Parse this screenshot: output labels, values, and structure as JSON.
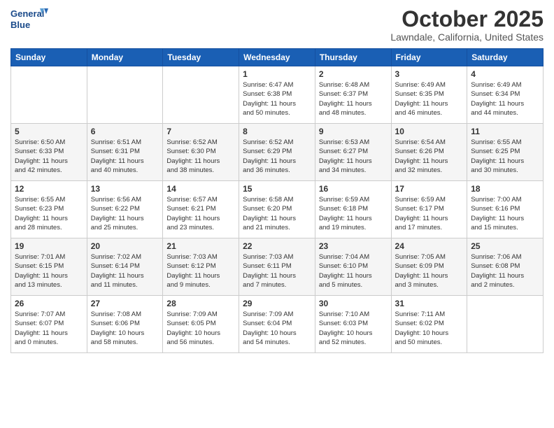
{
  "header": {
    "logo_line1": "General",
    "logo_line2": "Blue",
    "month": "October 2025",
    "location": "Lawndale, California, United States"
  },
  "days_of_week": [
    "Sunday",
    "Monday",
    "Tuesday",
    "Wednesday",
    "Thursday",
    "Friday",
    "Saturday"
  ],
  "weeks": [
    [
      {
        "day": "",
        "info": ""
      },
      {
        "day": "",
        "info": ""
      },
      {
        "day": "",
        "info": ""
      },
      {
        "day": "1",
        "info": "Sunrise: 6:47 AM\nSunset: 6:38 PM\nDaylight: 11 hours\nand 50 minutes."
      },
      {
        "day": "2",
        "info": "Sunrise: 6:48 AM\nSunset: 6:37 PM\nDaylight: 11 hours\nand 48 minutes."
      },
      {
        "day": "3",
        "info": "Sunrise: 6:49 AM\nSunset: 6:35 PM\nDaylight: 11 hours\nand 46 minutes."
      },
      {
        "day": "4",
        "info": "Sunrise: 6:49 AM\nSunset: 6:34 PM\nDaylight: 11 hours\nand 44 minutes."
      }
    ],
    [
      {
        "day": "5",
        "info": "Sunrise: 6:50 AM\nSunset: 6:33 PM\nDaylight: 11 hours\nand 42 minutes."
      },
      {
        "day": "6",
        "info": "Sunrise: 6:51 AM\nSunset: 6:31 PM\nDaylight: 11 hours\nand 40 minutes."
      },
      {
        "day": "7",
        "info": "Sunrise: 6:52 AM\nSunset: 6:30 PM\nDaylight: 11 hours\nand 38 minutes."
      },
      {
        "day": "8",
        "info": "Sunrise: 6:52 AM\nSunset: 6:29 PM\nDaylight: 11 hours\nand 36 minutes."
      },
      {
        "day": "9",
        "info": "Sunrise: 6:53 AM\nSunset: 6:27 PM\nDaylight: 11 hours\nand 34 minutes."
      },
      {
        "day": "10",
        "info": "Sunrise: 6:54 AM\nSunset: 6:26 PM\nDaylight: 11 hours\nand 32 minutes."
      },
      {
        "day": "11",
        "info": "Sunrise: 6:55 AM\nSunset: 6:25 PM\nDaylight: 11 hours\nand 30 minutes."
      }
    ],
    [
      {
        "day": "12",
        "info": "Sunrise: 6:55 AM\nSunset: 6:23 PM\nDaylight: 11 hours\nand 28 minutes."
      },
      {
        "day": "13",
        "info": "Sunrise: 6:56 AM\nSunset: 6:22 PM\nDaylight: 11 hours\nand 25 minutes."
      },
      {
        "day": "14",
        "info": "Sunrise: 6:57 AM\nSunset: 6:21 PM\nDaylight: 11 hours\nand 23 minutes."
      },
      {
        "day": "15",
        "info": "Sunrise: 6:58 AM\nSunset: 6:20 PM\nDaylight: 11 hours\nand 21 minutes."
      },
      {
        "day": "16",
        "info": "Sunrise: 6:59 AM\nSunset: 6:18 PM\nDaylight: 11 hours\nand 19 minutes."
      },
      {
        "day": "17",
        "info": "Sunrise: 6:59 AM\nSunset: 6:17 PM\nDaylight: 11 hours\nand 17 minutes."
      },
      {
        "day": "18",
        "info": "Sunrise: 7:00 AM\nSunset: 6:16 PM\nDaylight: 11 hours\nand 15 minutes."
      }
    ],
    [
      {
        "day": "19",
        "info": "Sunrise: 7:01 AM\nSunset: 6:15 PM\nDaylight: 11 hours\nand 13 minutes."
      },
      {
        "day": "20",
        "info": "Sunrise: 7:02 AM\nSunset: 6:14 PM\nDaylight: 11 hours\nand 11 minutes."
      },
      {
        "day": "21",
        "info": "Sunrise: 7:03 AM\nSunset: 6:12 PM\nDaylight: 11 hours\nand 9 minutes."
      },
      {
        "day": "22",
        "info": "Sunrise: 7:03 AM\nSunset: 6:11 PM\nDaylight: 11 hours\nand 7 minutes."
      },
      {
        "day": "23",
        "info": "Sunrise: 7:04 AM\nSunset: 6:10 PM\nDaylight: 11 hours\nand 5 minutes."
      },
      {
        "day": "24",
        "info": "Sunrise: 7:05 AM\nSunset: 6:09 PM\nDaylight: 11 hours\nand 3 minutes."
      },
      {
        "day": "25",
        "info": "Sunrise: 7:06 AM\nSunset: 6:08 PM\nDaylight: 11 hours\nand 2 minutes."
      }
    ],
    [
      {
        "day": "26",
        "info": "Sunrise: 7:07 AM\nSunset: 6:07 PM\nDaylight: 11 hours\nand 0 minutes."
      },
      {
        "day": "27",
        "info": "Sunrise: 7:08 AM\nSunset: 6:06 PM\nDaylight: 10 hours\nand 58 minutes."
      },
      {
        "day": "28",
        "info": "Sunrise: 7:09 AM\nSunset: 6:05 PM\nDaylight: 10 hours\nand 56 minutes."
      },
      {
        "day": "29",
        "info": "Sunrise: 7:09 AM\nSunset: 6:04 PM\nDaylight: 10 hours\nand 54 minutes."
      },
      {
        "day": "30",
        "info": "Sunrise: 7:10 AM\nSunset: 6:03 PM\nDaylight: 10 hours\nand 52 minutes."
      },
      {
        "day": "31",
        "info": "Sunrise: 7:11 AM\nSunset: 6:02 PM\nDaylight: 10 hours\nand 50 minutes."
      },
      {
        "day": "",
        "info": ""
      }
    ]
  ]
}
